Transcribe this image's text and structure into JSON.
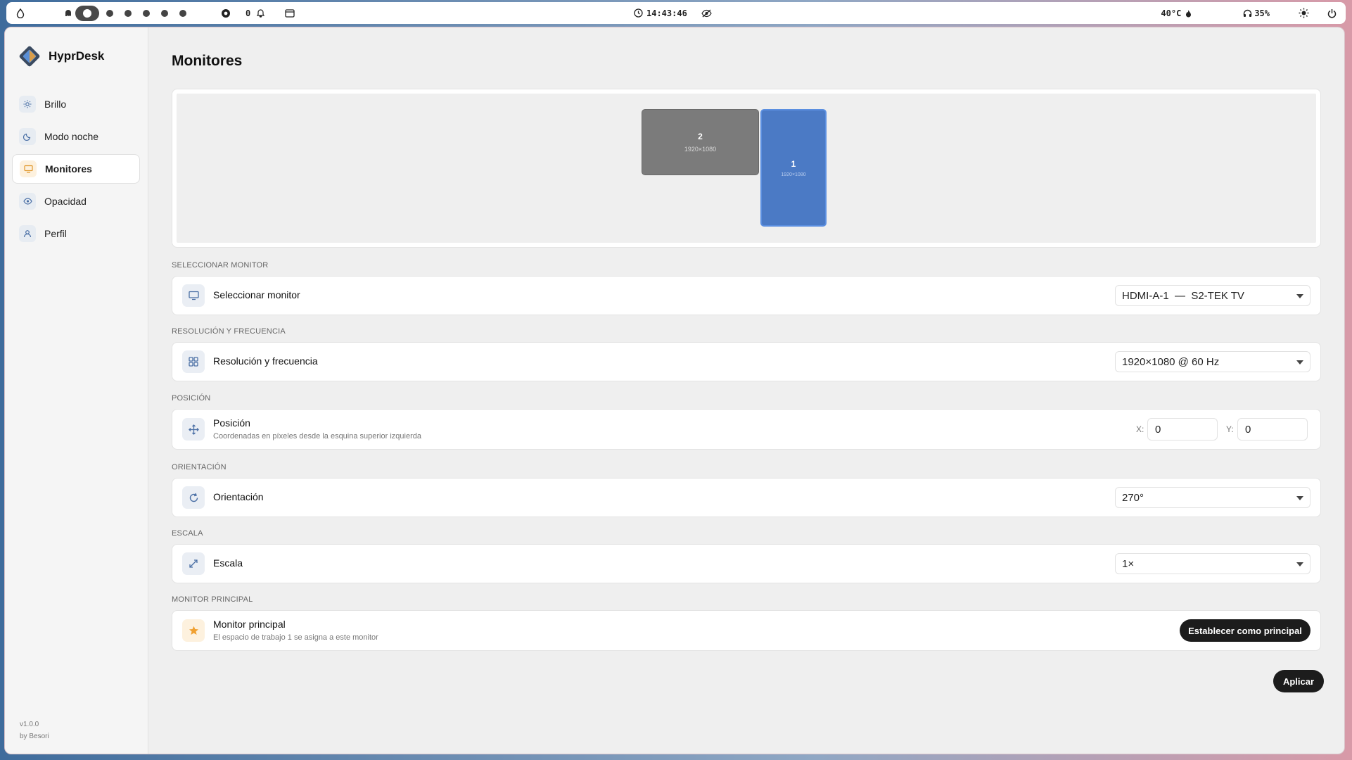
{
  "topbar": {
    "clock": "14:43:46",
    "notifications": "0",
    "temperature": "40°C",
    "volume": "35%",
    "icons": [
      "drop-icon",
      "ghost-icon",
      "chrome-icon",
      "bell-icon",
      "window-icon",
      "clock-icon",
      "eye-off-icon",
      "flame-icon",
      "headphones-icon",
      "sun-icon",
      "power-icon"
    ]
  },
  "app": {
    "name": "HyprDesk",
    "version": "v1.0.0",
    "author": "by Besori"
  },
  "sidebar": {
    "items": [
      {
        "label": "Brillo",
        "icon": "sun-icon"
      },
      {
        "label": "Modo noche",
        "icon": "moon-icon"
      },
      {
        "label": "Monitores",
        "icon": "monitor-icon",
        "active": true
      },
      {
        "label": "Opacidad",
        "icon": "eye-icon"
      },
      {
        "label": "Perfil",
        "icon": "user-icon"
      }
    ]
  },
  "page": {
    "title": "Monitores"
  },
  "preview": {
    "monitor_2": {
      "number": "2",
      "resolution": "1920×1080"
    },
    "monitor_1": {
      "number": "1",
      "resolution": "1920×1080"
    }
  },
  "sections": {
    "select_monitor": {
      "label": "SELECCIONAR MONITOR",
      "title": "Seleccionar monitor",
      "value": "HDMI-A-1  —  S2-TEK TV"
    },
    "resolution": {
      "label": "RESOLUCIÓN Y FRECUENCIA",
      "title": "Resolución y frecuencia",
      "value": "1920×1080 @ 60 Hz"
    },
    "position": {
      "label": "POSICIÓN",
      "title": "Posición",
      "subtitle": "Coordenadas en píxeles desde la esquina superior izquierda",
      "x_label": "X:",
      "x_value": "0",
      "y_label": "Y:",
      "y_value": "0"
    },
    "orientation": {
      "label": "ORIENTACIÓN",
      "title": "Orientación",
      "value": "270°"
    },
    "scale": {
      "label": "ESCALA",
      "title": "Escala",
      "value": "1×"
    },
    "primary": {
      "label": "MONITOR PRINCIPAL",
      "title": "Monitor principal",
      "subtitle": "El espacio de trabajo 1 se asigna a este monitor",
      "button": "Establecer como principal"
    }
  },
  "apply_button": "Aplicar",
  "colors": {
    "accent_blue": "#4b7ac5",
    "monitor_inactive": "#7b7b7b",
    "button_dark": "#1c1c1c",
    "star_orange": "#f0a030"
  }
}
